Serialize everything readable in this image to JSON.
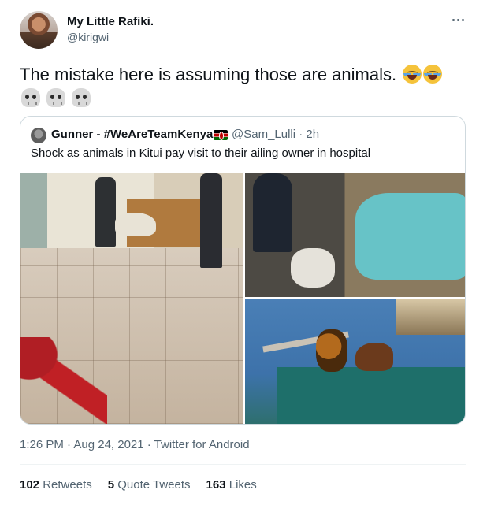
{
  "author": {
    "display_name": "My Little Rafiki.",
    "handle": "@kirigwi"
  },
  "tweet": {
    "text": "The mistake here is assuming those are animals.",
    "emojis": [
      "face-with-tears-of-joy",
      "face-with-tears-of-joy",
      "skull",
      "skull",
      "skull"
    ]
  },
  "quoted_tweet": {
    "display_name": "Gunner - #WeAreTeamKenya",
    "flag": "kenya-flag",
    "handle_time": "@Sam_Lulli · 2h",
    "text": "Shock as animals in Kitui pay visit to their ailing owner in hospital"
  },
  "meta": {
    "timestamp": "1:26 PM · Aug 24, 2021 · Twitter for Android"
  },
  "stats": {
    "retweets_count": "102",
    "retweets_label": "Retweets",
    "quotes_count": "5",
    "quotes_label": "Quote Tweets",
    "likes_count": "163",
    "likes_label": "Likes"
  },
  "colors": {
    "text": "#0f1419",
    "secondary": "#536471",
    "border": "#cfd9de"
  }
}
